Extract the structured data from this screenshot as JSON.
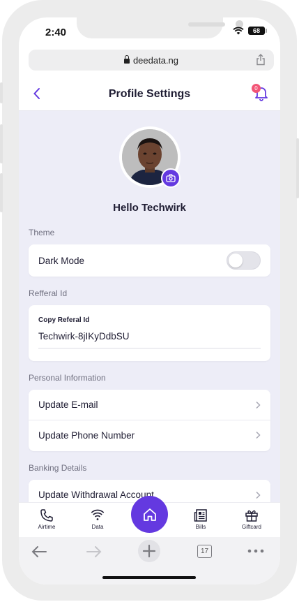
{
  "status": {
    "time": "2:40",
    "battery": "68"
  },
  "browser": {
    "url": "deedata.ng",
    "open_tabs": "17"
  },
  "header": {
    "title": "Profile Settings",
    "notification_count": "0"
  },
  "profile": {
    "greeting": "Hello Techwirk"
  },
  "sections": {
    "theme": {
      "label": "Theme",
      "dark_mode_label": "Dark Mode",
      "dark_mode_on": false
    },
    "referral": {
      "label": "Refferal Id",
      "field_label": "Copy Referal Id",
      "value": "Techwirk-8jIKyDdbSU"
    },
    "personal": {
      "label": "Personal Information",
      "items": [
        "Update E-mail",
        "Update Phone Number"
      ]
    },
    "banking": {
      "label": "Banking Details",
      "items": [
        "Update Withdrawal Account"
      ]
    }
  },
  "tabbar": {
    "airtime": "Airtime",
    "data": "Data",
    "bills": "Bills",
    "giftcard": "Giftcard"
  },
  "colors": {
    "accent": "#6439e0",
    "background": "#ededf7",
    "badge": "#f25576"
  },
  "icons": [
    "back-icon",
    "bell-icon",
    "camera-icon",
    "chevron-right-icon",
    "phone-icon",
    "wifi-icon",
    "home-icon",
    "bills-icon",
    "gift-icon",
    "share-icon",
    "lock-icon"
  ]
}
